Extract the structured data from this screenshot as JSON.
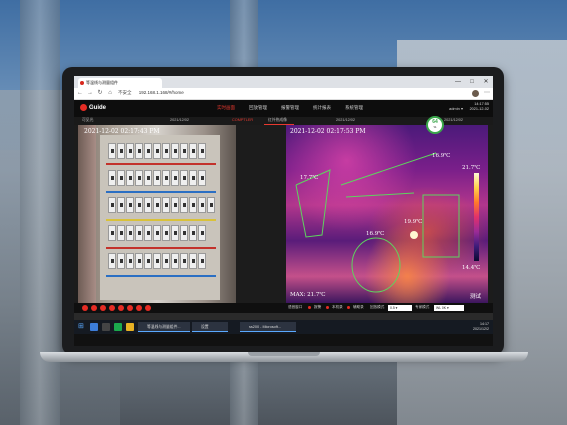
{
  "browser": {
    "tab_title": "等温线与测量组件",
    "url_warning": "不安全",
    "url": "192.168.1.168/#/home",
    "win_minimize": "—",
    "win_maximize": "□",
    "win_close": "✕"
  },
  "app": {
    "logo": "Guide",
    "menu": [
      "实时画面",
      "回放管理",
      "报警管理",
      "统计报表",
      "系统管理"
    ],
    "active_menu": "实时画面",
    "user": "admin ▾",
    "clock_time": "14:17:55",
    "clock_date": "2021-12-02",
    "sub_left": "可见光",
    "sub_mid1": "2021/12/02",
    "sub_mid2": "COMPTLER",
    "sub_mid3": "红外热成像",
    "sub_mid4": "2021/12/02",
    "sub_right": "2021/12/02"
  },
  "battery": {
    "value": "64",
    "unit": "%"
  },
  "visible_panel": {
    "timestamp": "2021-12-02 02:17:43 PM"
  },
  "thermal_panel": {
    "timestamp": "2021-12-02 02:17:53 PM",
    "labels": {
      "t1": "16.9℃",
      "t2": "17.7℃",
      "t3": "19.9℃",
      "t4": "16.9℃",
      "scale_max": "21.7℃",
      "scale_min": "14.4℃",
      "max": "MAX: 21.7℃",
      "test": "测试"
    }
  },
  "toolbar": {
    "l1": "语音窗口",
    "l2": "报警",
    "l3": "本机录",
    "l4": "键控压",
    "l5": "辅助录",
    "l6": "回放模式",
    "select_value": "0.5 ▾",
    "l7": "专家模式",
    "select2_value": "WL 0K ▾"
  },
  "taskbar": {
    "start_icon": "windows-icon",
    "app1": "等温线与测量组件...",
    "app2": "设置",
    "app3": "ss200 - Microsoft...",
    "tray_time": "14:17",
    "tray_date": "2021/12/2"
  },
  "colors": {
    "accent_red": "#e8392f",
    "battery_green": "#3aa64b",
    "isotherm_green": "#5fd35f"
  }
}
